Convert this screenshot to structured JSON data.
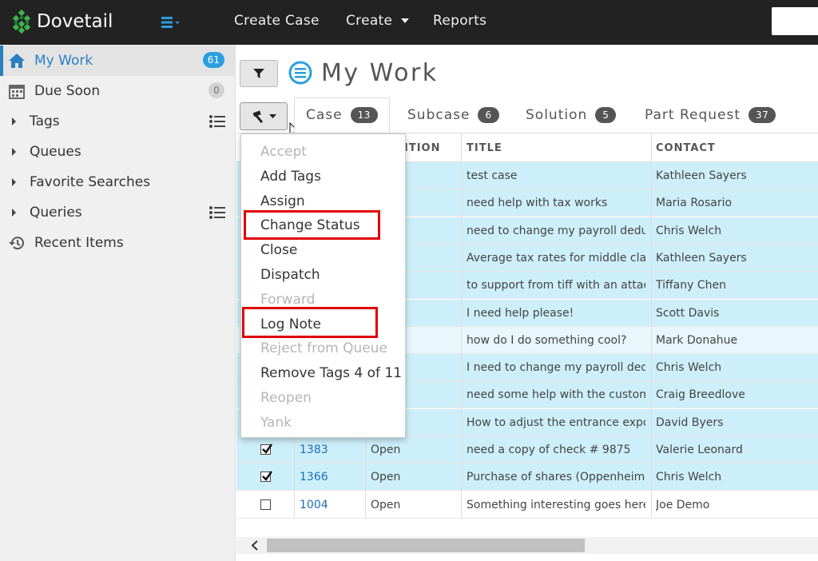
{
  "brand": {
    "name": "Dovetail"
  },
  "nav": {
    "links": [
      "Create Case",
      "Create",
      "Reports"
    ]
  },
  "sidebar": {
    "items": [
      {
        "label": "My Work",
        "badge": "61"
      },
      {
        "label": "Due Soon",
        "badge": "0"
      },
      {
        "label": "Tags"
      },
      {
        "label": "Queues"
      },
      {
        "label": "Favorite Searches"
      },
      {
        "label": "Queries"
      },
      {
        "label": "Recent Items"
      }
    ]
  },
  "page": {
    "title": "My Work"
  },
  "tabs": [
    {
      "label": "Case",
      "count": "13"
    },
    {
      "label": "Subcase",
      "count": "6"
    },
    {
      "label": "Solution",
      "count": "5"
    },
    {
      "label": "Part Request",
      "count": "37"
    }
  ],
  "table": {
    "headers": [
      "ITION",
      "TITLE",
      "CONTACT"
    ],
    "rows": [
      {
        "id": "",
        "condition": "",
        "title": "test case",
        "contact": "Kathleen Sayers",
        "checked": true
      },
      {
        "id": "",
        "condition": "",
        "title": "need help with tax works",
        "contact": "Maria Rosario",
        "checked": true
      },
      {
        "id": "",
        "condition": "",
        "title": "need to change my payroll deduct",
        "contact": "Chris Welch",
        "checked": true
      },
      {
        "id": "",
        "condition": "",
        "title": "Average tax rates for middle class",
        "contact": "Kathleen Sayers",
        "checked": true
      },
      {
        "id": "",
        "condition": "",
        "title": "to support from tiff with an attach",
        "contact": "Tiffany Chen",
        "checked": true
      },
      {
        "id": "",
        "condition": "",
        "title": "I need help please!",
        "contact": "Scott Davis",
        "checked": true
      },
      {
        "id": "",
        "condition": "",
        "title": "how do I do something cool?",
        "contact": "Mark Donahue",
        "checked": false
      },
      {
        "id": "",
        "condition": "",
        "title": "I need to change my payroll deduc",
        "contact": "Chris Welch",
        "checked": true
      },
      {
        "id": "",
        "condition": "",
        "title": "need some help with the custom a",
        "contact": "Craig Breedlove",
        "checked": true
      },
      {
        "id": "",
        "condition": "",
        "title": "How to adjust the entrance exposu",
        "contact": "David Byers",
        "checked": true
      },
      {
        "id": "1383",
        "condition": "Open",
        "title": "need a copy of check # 9875",
        "contact": "Valerie Leonard",
        "checked": true
      },
      {
        "id": "1366",
        "condition": "Open",
        "title": "Purchase of shares (Oppenheimer",
        "contact": "Chris Welch",
        "checked": true
      },
      {
        "id": "1004",
        "condition": "Open",
        "title": "Something interesting goes here",
        "contact": "Joe Demo",
        "checked": false
      }
    ]
  },
  "dropdown": {
    "items": [
      {
        "label": "Accept",
        "disabled": true
      },
      {
        "label": "Add Tags",
        "disabled": false
      },
      {
        "label": "Assign",
        "disabled": false
      },
      {
        "label": "Change Status",
        "disabled": false
      },
      {
        "label": "Close",
        "disabled": false
      },
      {
        "label": "Dispatch",
        "disabled": false
      },
      {
        "label": "Forward",
        "disabled": true
      },
      {
        "label": "Log Note",
        "disabled": false
      },
      {
        "label": "Reject from Queue",
        "disabled": true
      },
      {
        "label": "Remove Tags 4 of 11",
        "disabled": false
      },
      {
        "label": "Reopen",
        "disabled": true
      },
      {
        "label": "Yank",
        "disabled": true
      }
    ]
  },
  "colors": {
    "topbar": "#222222",
    "accent": "#2a7fc1",
    "selected_row": "#cdeffa",
    "highlight": "#e00000",
    "logo_green": "#3bb54a"
  }
}
